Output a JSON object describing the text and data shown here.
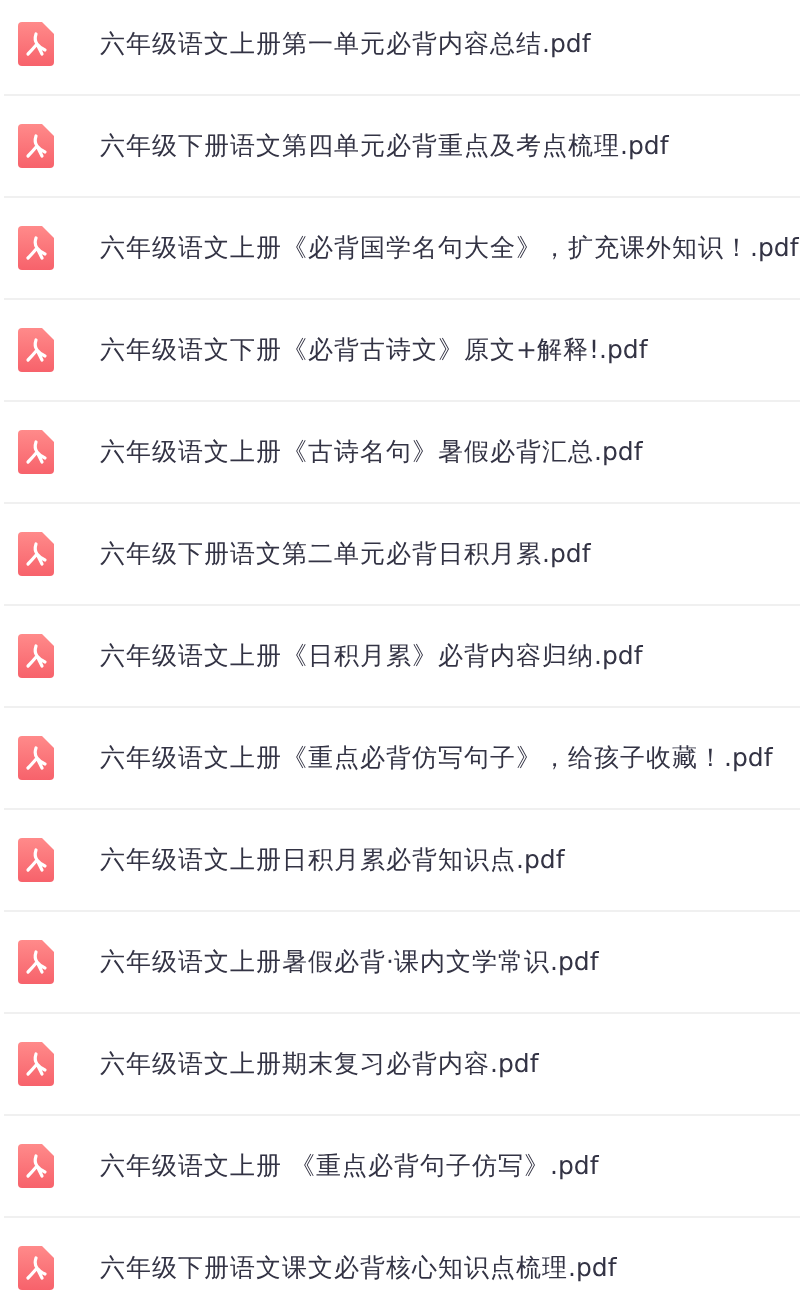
{
  "files": [
    {
      "name": "六年级语文上册第一单元必背内容总结.pdf"
    },
    {
      "name": "六年级下册语文第四单元必背重点及考点梳理.pdf"
    },
    {
      "name": "六年级语文上册《必背国学名句大全》，扩充课外知识！.pdf"
    },
    {
      "name": "六年级语文下册《必背古诗文》原文+解释!.pdf"
    },
    {
      "name": "六年级语文上册《古诗名句》暑假必背汇总.pdf"
    },
    {
      "name": "六年级下册语文第二单元必背日积月累.pdf"
    },
    {
      "name": "六年级语文上册《日积月累》必背内容归纳.pdf"
    },
    {
      "name": "六年级语文上册《重点必背仿写句子》，给孩子收藏！.pdf"
    },
    {
      "name": "六年级语文上册日积月累必背知识点.pdf"
    },
    {
      "name": "六年级语文上册暑假必背·课内文学常识.pdf"
    },
    {
      "name": "六年级语文上册期末复习必背内容.pdf"
    },
    {
      "name": "六年级语文上册 《重点必背句子仿写》.pdf"
    },
    {
      "name": "六年级下册语文课文必背核心知识点梳理.pdf"
    }
  ]
}
